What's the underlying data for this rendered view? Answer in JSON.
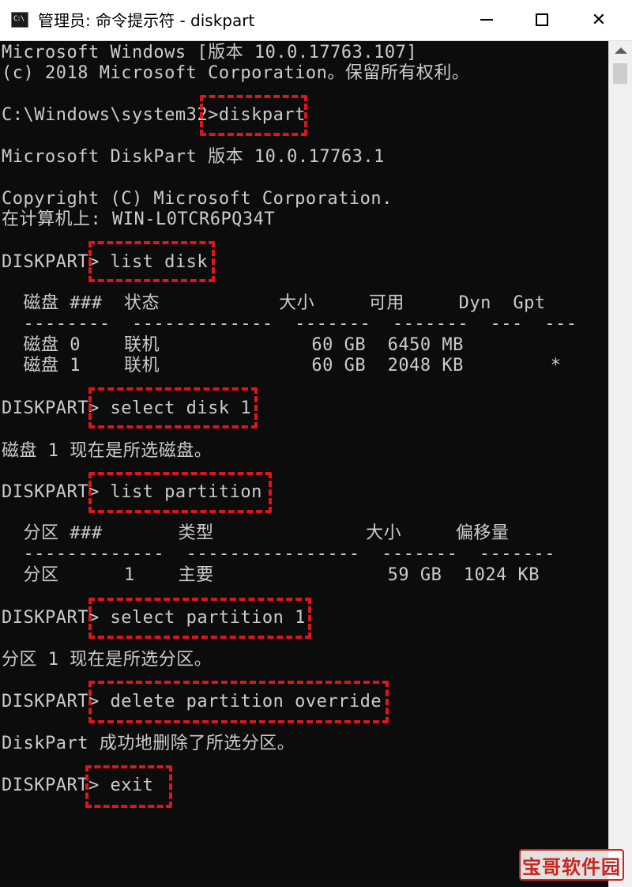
{
  "window": {
    "title": "管理员: 命令提示符 - diskpart",
    "icon_label": "C:\\",
    "app_icon": "cmd-icon",
    "controls": {
      "minimize": "minimize-icon",
      "maximize": "maximize-icon",
      "close_glyph": "✕"
    }
  },
  "colors": {
    "console_bg": "#0c0c0c",
    "console_text": "#cccccc",
    "highlight_box": "#e0141e",
    "titlebar_bg": "#ffffff"
  },
  "console": {
    "lines": [
      "Microsoft Windows [版本 10.0.17763.107]",
      "(c) 2018 Microsoft Corporation。保留所有权利。",
      "C:\\Windows\\system32>diskpart",
      "Microsoft DiskPart 版本 10.0.17763.1",
      "Copyright (C) Microsoft Corporation.",
      "在计算机上: WIN-L0TCR6PQ34T",
      "DISKPART> list disk",
      "  磁盘 ###  状态           大小     可用     Dyn  Gpt",
      "  --------  -------------  -------  -------  ---  ---",
      "  磁盘 0    联机              60 GB  6450 MB",
      "  磁盘 1    联机              60 GB  2048 KB        *",
      "DISKPART> select disk 1",
      "磁盘 1 现在是所选磁盘。",
      "DISKPART> list partition",
      "  分区 ###       类型              大小     偏移量",
      "  -------------  ----------------  -------  -------",
      "  分区      1    主要                59 GB  1024 KB",
      "DISKPART> select partition 1",
      "分区 1 现在是所选分区。",
      "DISKPART> delete partition override",
      "DiskPart 成功地删除了所选分区。",
      "DISKPART> exit"
    ]
  },
  "watermark": {
    "text": "宝哥软件园"
  }
}
